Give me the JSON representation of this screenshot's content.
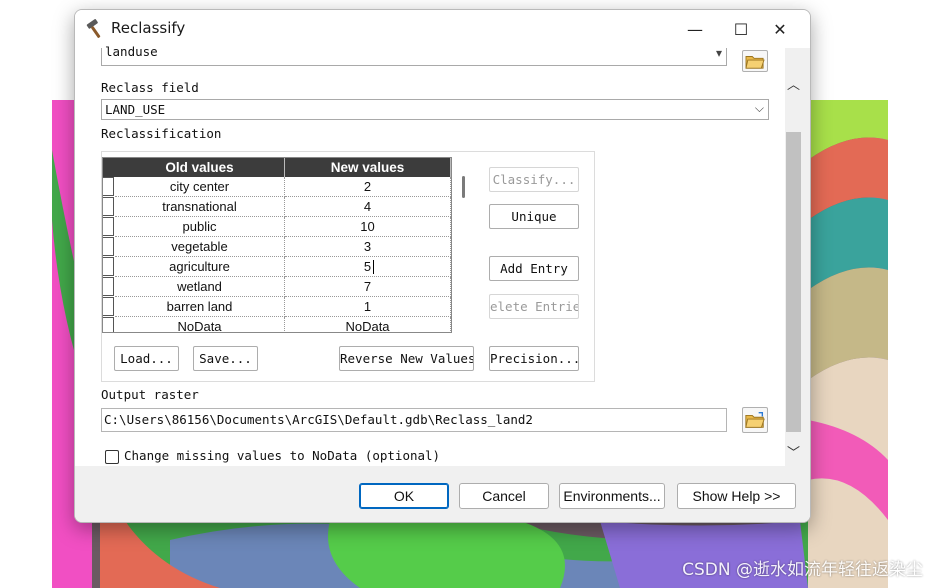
{
  "window": {
    "title": "Reclassify",
    "minimize_glyph": "—",
    "maximize_glyph": "☐",
    "close_glyph": "✕"
  },
  "input_raster": {
    "value": "landuse"
  },
  "reclass_field": {
    "label": "Reclass field",
    "value": "LAND_USE"
  },
  "reclassification": {
    "label": "Reclassification",
    "columns": [
      "Old values",
      "New values"
    ],
    "rows": [
      {
        "old": "city center",
        "new": "2"
      },
      {
        "old": "transnational",
        "new": "4"
      },
      {
        "old": "public",
        "new": "10"
      },
      {
        "old": "vegetable",
        "new": "3"
      },
      {
        "old": "agriculture",
        "new": "5"
      },
      {
        "old": "wetland",
        "new": "7"
      },
      {
        "old": "barren land",
        "new": "1"
      },
      {
        "old": "NoData",
        "new": "NoData"
      }
    ],
    "buttons": {
      "classify": "Classify...",
      "unique": "Unique",
      "add_entry": "Add Entry",
      "delete_entries": "elete Entrie",
      "load": "Load...",
      "save": "Save...",
      "reverse": "Reverse New Values",
      "precision": "Precision..."
    }
  },
  "output_raster": {
    "label": "Output raster",
    "value": "C:\\Users\\86156\\Documents\\ArcGIS\\Default.gdb\\Reclass_land2"
  },
  "change_missing": {
    "label": "Change missing values to NoData (optional)",
    "checked": false
  },
  "footer": {
    "ok": "OK",
    "cancel": "Cancel",
    "environments": "Environments...",
    "show_help": "Show Help >>"
  },
  "watermark": "CSDN @逝水如流年轻往返染尘",
  "colors": {
    "header_bg": "#3c3c3c",
    "accent": "#0067c0"
  }
}
